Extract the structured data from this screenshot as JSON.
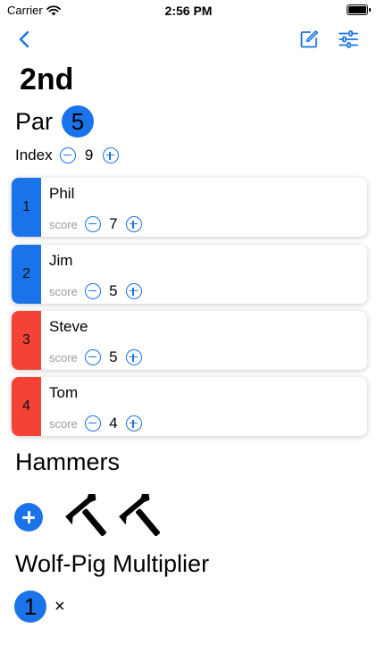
{
  "status_bar": {
    "carrier": "Carrier",
    "time": "2:56 PM"
  },
  "nav": {
    "back_icon": "chevron-left-icon",
    "edit_icon": "square-pencil-icon",
    "settings_icon": "sliders-icon"
  },
  "hole": {
    "title": "2nd",
    "par_label": "Par",
    "par_value": "5",
    "index_label": "Index",
    "index_value": "9"
  },
  "score_label": "score",
  "players": [
    {
      "position": "1",
      "name": "Phil",
      "score": "7",
      "color": "#1a73e8"
    },
    {
      "position": "2",
      "name": "Jim",
      "score": "5",
      "color": "#1a73e8"
    },
    {
      "position": "3",
      "name": "Steve",
      "score": "5",
      "color": "#f44336"
    },
    {
      "position": "4",
      "name": "Tom",
      "score": "4",
      "color": "#f44336"
    }
  ],
  "hammers": {
    "title": "Hammers",
    "count": 2,
    "icon": "hammer-icon"
  },
  "multiplier": {
    "title": "Wolf-Pig Multiplier",
    "value": "1",
    "suffix": "×"
  },
  "colors": {
    "accent": "#1a73e8",
    "red": "#f44336"
  }
}
